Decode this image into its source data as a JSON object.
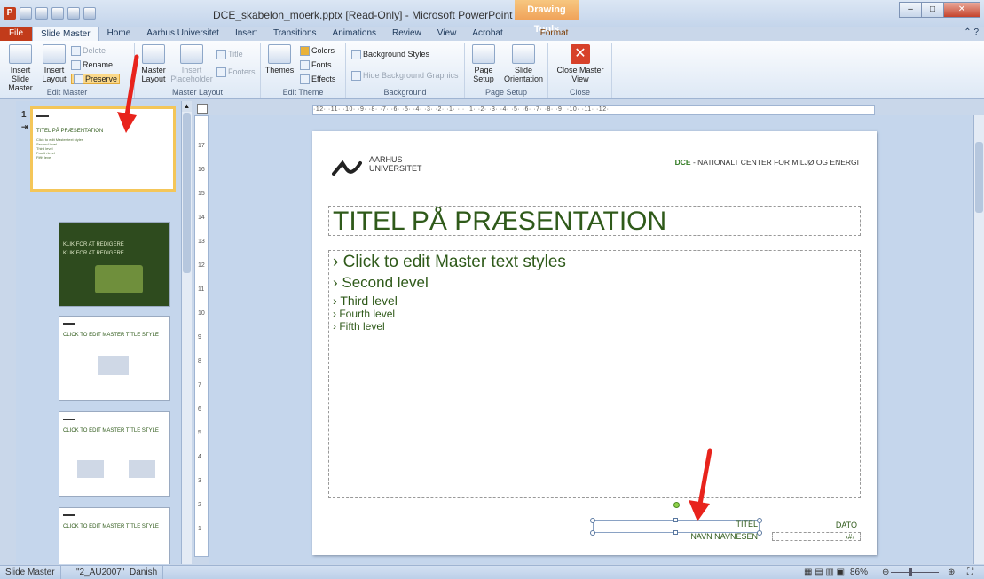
{
  "app": {
    "window_title": "DCE_skabelon_moerk.pptx [Read-Only] - Microsoft PowerPoint",
    "contextual_tab_group": "Drawing Tools",
    "app_icon_letter": "P"
  },
  "tabs": [
    "File",
    "Slide Master",
    "Home",
    "Aarhus Universitet",
    "Insert",
    "Transitions",
    "Animations",
    "Review",
    "View",
    "Acrobat",
    "Format"
  ],
  "ribbon": {
    "edit_master": {
      "label": "Edit Master",
      "insert_slide_master": "Insert Slide Master",
      "insert_layout": "Insert Layout",
      "delete": "Delete",
      "rename": "Rename",
      "preserve": "Preserve"
    },
    "master_layout": {
      "label": "Master Layout",
      "master_layout": "Master Layout",
      "insert_placeholder": "Insert Placeholder",
      "title": "Title",
      "footers": "Footers"
    },
    "edit_theme": {
      "label": "Edit Theme",
      "themes": "Themes",
      "colors": "Colors",
      "fonts": "Fonts",
      "effects": "Effects"
    },
    "background": {
      "label": "Background",
      "background_styles": "Background Styles",
      "hide_background_graphics": "Hide Background Graphics"
    },
    "page_setup": {
      "label": "Page Setup",
      "page_setup": "Page Setup",
      "slide_orientation": "Slide Orientation"
    },
    "close": {
      "label": "Close",
      "close_master_view": "Close Master View"
    }
  },
  "thumbnails": {
    "first_number": "1",
    "items": [
      {
        "title": "TITEL PÅ PRÆSENTATION",
        "lines": [
          "Click to edit Master text styles",
          "Second level",
          "Third level",
          "Fourth level",
          "Fifth level"
        ]
      },
      {
        "title": "KLIK FOR AT REDIGERE",
        "subtitle": "KLIK FOR AT REDIGERE"
      },
      {
        "title": "CLICK TO EDIT MASTER TITLE STYLE"
      },
      {
        "title": "CLICK TO EDIT MASTER TITLE STYLE"
      },
      {
        "title": "CLICK TO EDIT MASTER TITLE STYLE"
      }
    ]
  },
  "ruler": {
    "horizontal": "·12· ·11· ·10· ·9· ·8· ·7· ·6· ·5· ·4· ·3· ·2· ·1· · · ·1· ·2· ·3· ·4· ·5· ·6· ·7· ·8· ·9· ·10· ·11· ·12·",
    "vertical": [
      "17",
      "16",
      "15",
      "14",
      "13",
      "12",
      "11",
      "10",
      "9",
      "8",
      "7",
      "6",
      "5",
      "4",
      "3",
      "2",
      "1"
    ]
  },
  "slide": {
    "logo_line1": "AARHUS",
    "logo_line2": "UNIVERSITET",
    "dce_prefix": "DCE",
    "dce_rest": " - NATIONALT CENTER FOR MILJØ OG ENERGI",
    "title": "TITEL PÅ PRÆSENTATION",
    "levels": [
      "Click to edit Master text styles",
      "Second level",
      "Third level",
      "Fourth level",
      "Fifth level"
    ],
    "footer_title": "TITEL",
    "footer_name": "NAVN NAVNESEN",
    "footer_dato": "DATO",
    "footer_num": "‹#›"
  },
  "status": {
    "view": "Slide Master",
    "theme": "\"2_AU2007\"",
    "language": "Danish",
    "zoom": "86%"
  },
  "colors": {
    "accent_green": "#2f5a1a",
    "arrow_red": "#e8231c",
    "file_tab": "#c23b1a"
  }
}
